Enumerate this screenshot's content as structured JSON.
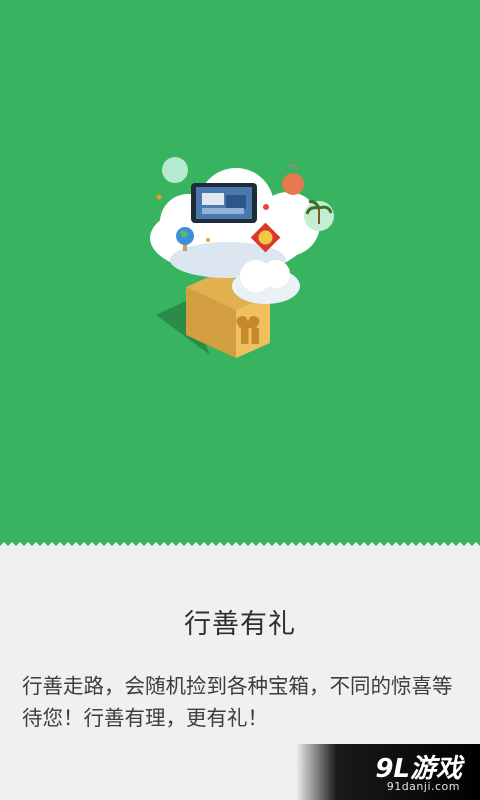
{
  "onboarding": {
    "title": "行善有礼",
    "description": "行善走路，会随机捡到各种宝箱，不同的惊喜等待您！行善有理，更有礼！"
  },
  "watermark": {
    "logo": "9L游戏",
    "url": "91danji.com"
  },
  "colors": {
    "hero_background": "#38b35f",
    "content_background": "#f0f0f0",
    "title_text": "#2e2e2e",
    "body_text": "#3d3d3d"
  },
  "icons": [
    "cloud-icon",
    "gift-box-icon",
    "tablet-icon",
    "globe-icon",
    "fu-charm-icon",
    "tag-icon",
    "palm-tree-icon"
  ]
}
